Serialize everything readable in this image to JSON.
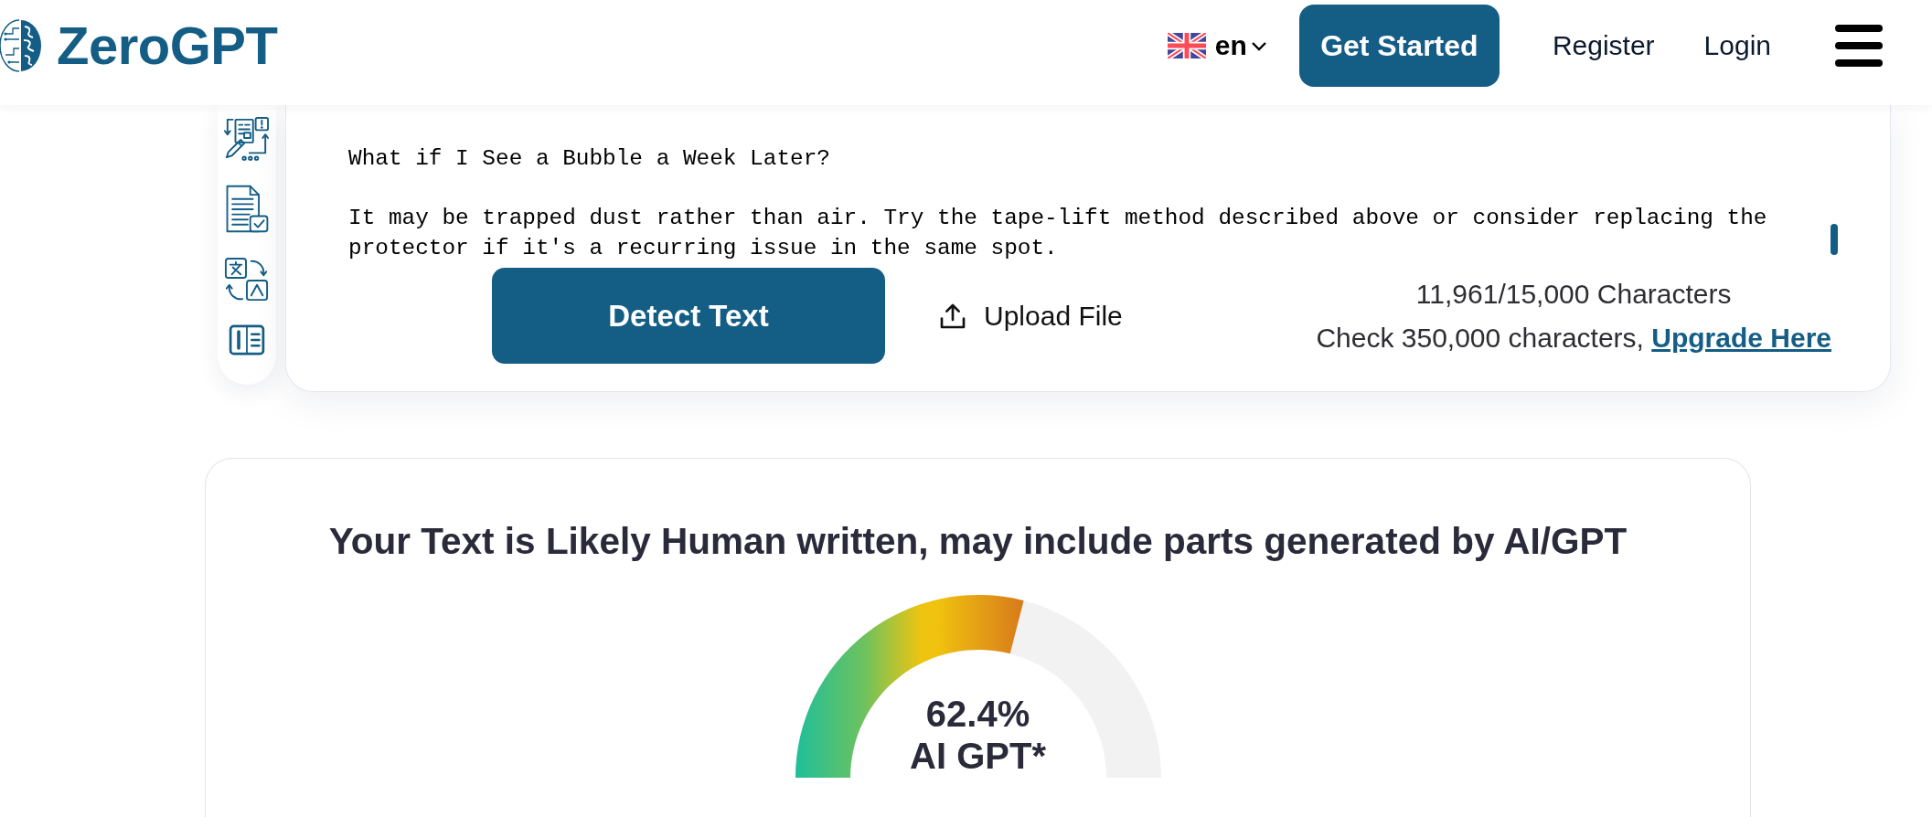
{
  "header": {
    "logo": "ZeroGPT",
    "language": "en",
    "nav": [
      {
        "label": "Get Started",
        "kind": "button"
      },
      {
        "label": "Register",
        "kind": "link"
      },
      {
        "label": "Login",
        "kind": "link"
      }
    ]
  },
  "editor": {
    "value": "What if I See a Bubble a Week Later?\n\nIt may be trapped dust rather than air. Try the tape-lift method described above or consider replacing the protector if it's a recurring issue in the same spot.",
    "detect_button": "Detect Text",
    "upload_button": "Upload File",
    "count": "11,961/15,000 Characters",
    "upgrade_note": {
      "text": "Check 350,000 characters,",
      "link": "Upgrade Here"
    }
  },
  "result": {
    "heading": "Your Text is Likely Human written, may include parts generated by AI/GPT",
    "gauge": {
      "level": 0.624,
      "value": "62.4%",
      "label": "AI GPT*"
    }
  }
}
